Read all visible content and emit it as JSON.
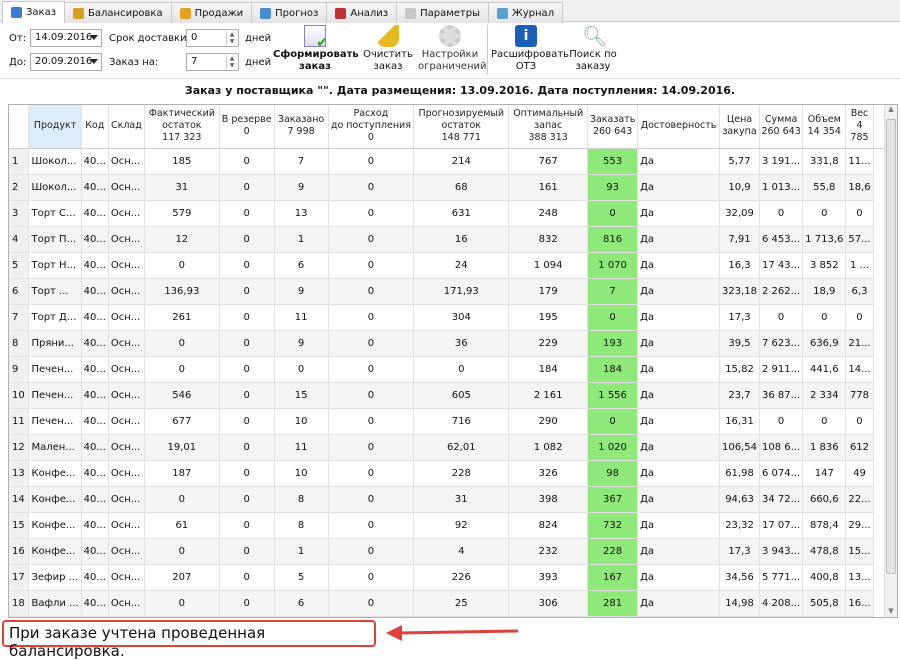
{
  "tabs": [
    {
      "label": "Заказ",
      "icon": "order-icon",
      "color": "#3a7bd5",
      "active": true
    },
    {
      "label": "Балансировка",
      "icon": "scales-icon",
      "color": "#d4a017"
    },
    {
      "label": "Продажи",
      "icon": "sales-icon",
      "color": "#e8a020"
    },
    {
      "label": "Прогноз",
      "icon": "forecast-chart-icon",
      "color": "#4a8ad0"
    },
    {
      "label": "Анализ",
      "icon": "analysis-pie-icon",
      "color": "#c03030"
    },
    {
      "label": "Параметры",
      "icon": "gear-icon",
      "color": "#c8c8c8"
    },
    {
      "label": "Журнал",
      "icon": "journal-icon",
      "color": "#5aa0d0"
    }
  ],
  "filters": {
    "from_label": "От:",
    "from_value": "14.09.2016",
    "to_label": "До:",
    "to_value": "20.09.2016",
    "delivery_label": "Срок доставки:",
    "delivery_value": "0",
    "order_for_label": "Заказ на:",
    "order_for_value": "7",
    "days_label": "дней"
  },
  "toolbar": {
    "form_order": "Сформировать заказ",
    "clear_order": "Очистить заказ",
    "settings": "Настройки ограничений",
    "decode": "Расшифровать ОТЗ",
    "search": "Поиск по заказу"
  },
  "title": "Заказ у поставщика \"\". Дата размещения: 13.09.2016. Дата поступления: 14.09.2016.",
  "columns": [
    "",
    "Продукт",
    "Код",
    "Склад",
    "Фактический\nостаток\n117 323",
    "В резерве\n0",
    "Заказано\n7 998",
    "Расход\nдо поступления\n0",
    "Прогнозируемый\nостаток\n148 771",
    "Оптимальный\nзапас\n388 313",
    "Заказать\n260 643",
    "Достоверность",
    "Цена\nзакупа",
    "Сумма\n260 643",
    "Объем\n14 354",
    "Вес\n4 785"
  ],
  "rows": [
    [
      "1",
      "Шокол...",
      "40...",
      "Осн...",
      "185",
      "0",
      "7",
      "0",
      "214",
      "767",
      "553",
      "Да",
      "5,77",
      "3 191...",
      "331,8",
      "11..."
    ],
    [
      "2",
      "Шокол...",
      "40...",
      "Осн...",
      "31",
      "0",
      "9",
      "0",
      "68",
      "161",
      "93",
      "Да",
      "10,9",
      "1 013...",
      "55,8",
      "18,6"
    ],
    [
      "3",
      "Торт С...",
      "40...",
      "Осн...",
      "579",
      "0",
      "13",
      "0",
      "631",
      "248",
      "0",
      "Да",
      "32,09",
      "0",
      "0",
      "0"
    ],
    [
      "4",
      "Торт П...",
      "40...",
      "Осн...",
      "12",
      "0",
      "1",
      "0",
      "16",
      "832",
      "816",
      "Да",
      "7,91",
      "6 453...",
      "1 713,6",
      "57..."
    ],
    [
      "5",
      "Торт Н...",
      "40...",
      "Осн...",
      "0",
      "0",
      "6",
      "0",
      "24",
      "1 094",
      "1 070",
      "Да",
      "16,3",
      "17 43...",
      "3 852",
      "1 ..."
    ],
    [
      "6",
      "Торт ...",
      "40...",
      "Осн...",
      "136,93",
      "0",
      "9",
      "0",
      "171,93",
      "179",
      "7",
      "Да",
      "323,18",
      "2 262...",
      "18,9",
      "6,3"
    ],
    [
      "7",
      "Торт Д...",
      "40...",
      "Осн...",
      "261",
      "0",
      "11",
      "0",
      "304",
      "195",
      "0",
      "Да",
      "17,3",
      "0",
      "0",
      "0"
    ],
    [
      "8",
      "Пряни...",
      "40...",
      "Осн...",
      "0",
      "0",
      "9",
      "0",
      "36",
      "229",
      "193",
      "Да",
      "39,5",
      "7 623...",
      "636,9",
      "21..."
    ],
    [
      "9",
      "Печен...",
      "40...",
      "Осн...",
      "0",
      "0",
      "0",
      "0",
      "0",
      "184",
      "184",
      "Да",
      "15,82",
      "2 911...",
      "441,6",
      "14..."
    ],
    [
      "10",
      "Печен...",
      "40...",
      "Осн...",
      "546",
      "0",
      "15",
      "0",
      "605",
      "2 161",
      "1 556",
      "Да",
      "23,7",
      "36 87...",
      "2 334",
      "778"
    ],
    [
      "11",
      "Печен...",
      "40...",
      "Осн...",
      "677",
      "0",
      "10",
      "0",
      "716",
      "290",
      "0",
      "Да",
      "16,31",
      "0",
      "0",
      "0"
    ],
    [
      "12",
      "Мален...",
      "40...",
      "Осн...",
      "19,01",
      "0",
      "11",
      "0",
      "62,01",
      "1 082",
      "1 020",
      "Да",
      "106,54",
      "108 6...",
      "1 836",
      "612"
    ],
    [
      "13",
      "Конфе...",
      "40...",
      "Осн...",
      "187",
      "0",
      "10",
      "0",
      "228",
      "326",
      "98",
      "Да",
      "61,98",
      "6 074...",
      "147",
      "49"
    ],
    [
      "14",
      "Конфе...",
      "40...",
      "Осн...",
      "0",
      "0",
      "8",
      "0",
      "31",
      "398",
      "367",
      "Да",
      "94,63",
      "34 72...",
      "660,6",
      "22..."
    ],
    [
      "15",
      "Конфе...",
      "40...",
      "Осн...",
      "61",
      "0",
      "8",
      "0",
      "92",
      "824",
      "732",
      "Да",
      "23,32",
      "17 07...",
      "878,4",
      "29..."
    ],
    [
      "16",
      "Конфе...",
      "40...",
      "Осн...",
      "0",
      "0",
      "1",
      "0",
      "4",
      "232",
      "228",
      "Да",
      "17,3",
      "3 943...",
      "478,8",
      "15..."
    ],
    [
      "17",
      "Зефир ...",
      "40...",
      "Осн...",
      "207",
      "0",
      "5",
      "0",
      "226",
      "393",
      "167",
      "Да",
      "34,56",
      "5 771...",
      "400,8",
      "13..."
    ],
    [
      "18",
      "Вафли ...",
      "40...",
      "Осн...",
      "0",
      "0",
      "6",
      "0",
      "25",
      "306",
      "281",
      "Да",
      "14,98",
      "4 208...",
      "505,8",
      "16..."
    ]
  ],
  "highlight_color": "#8fe87a",
  "annotation": "При заказе учтена проведенная балансировка.",
  "annotation_color": "#e0403a"
}
